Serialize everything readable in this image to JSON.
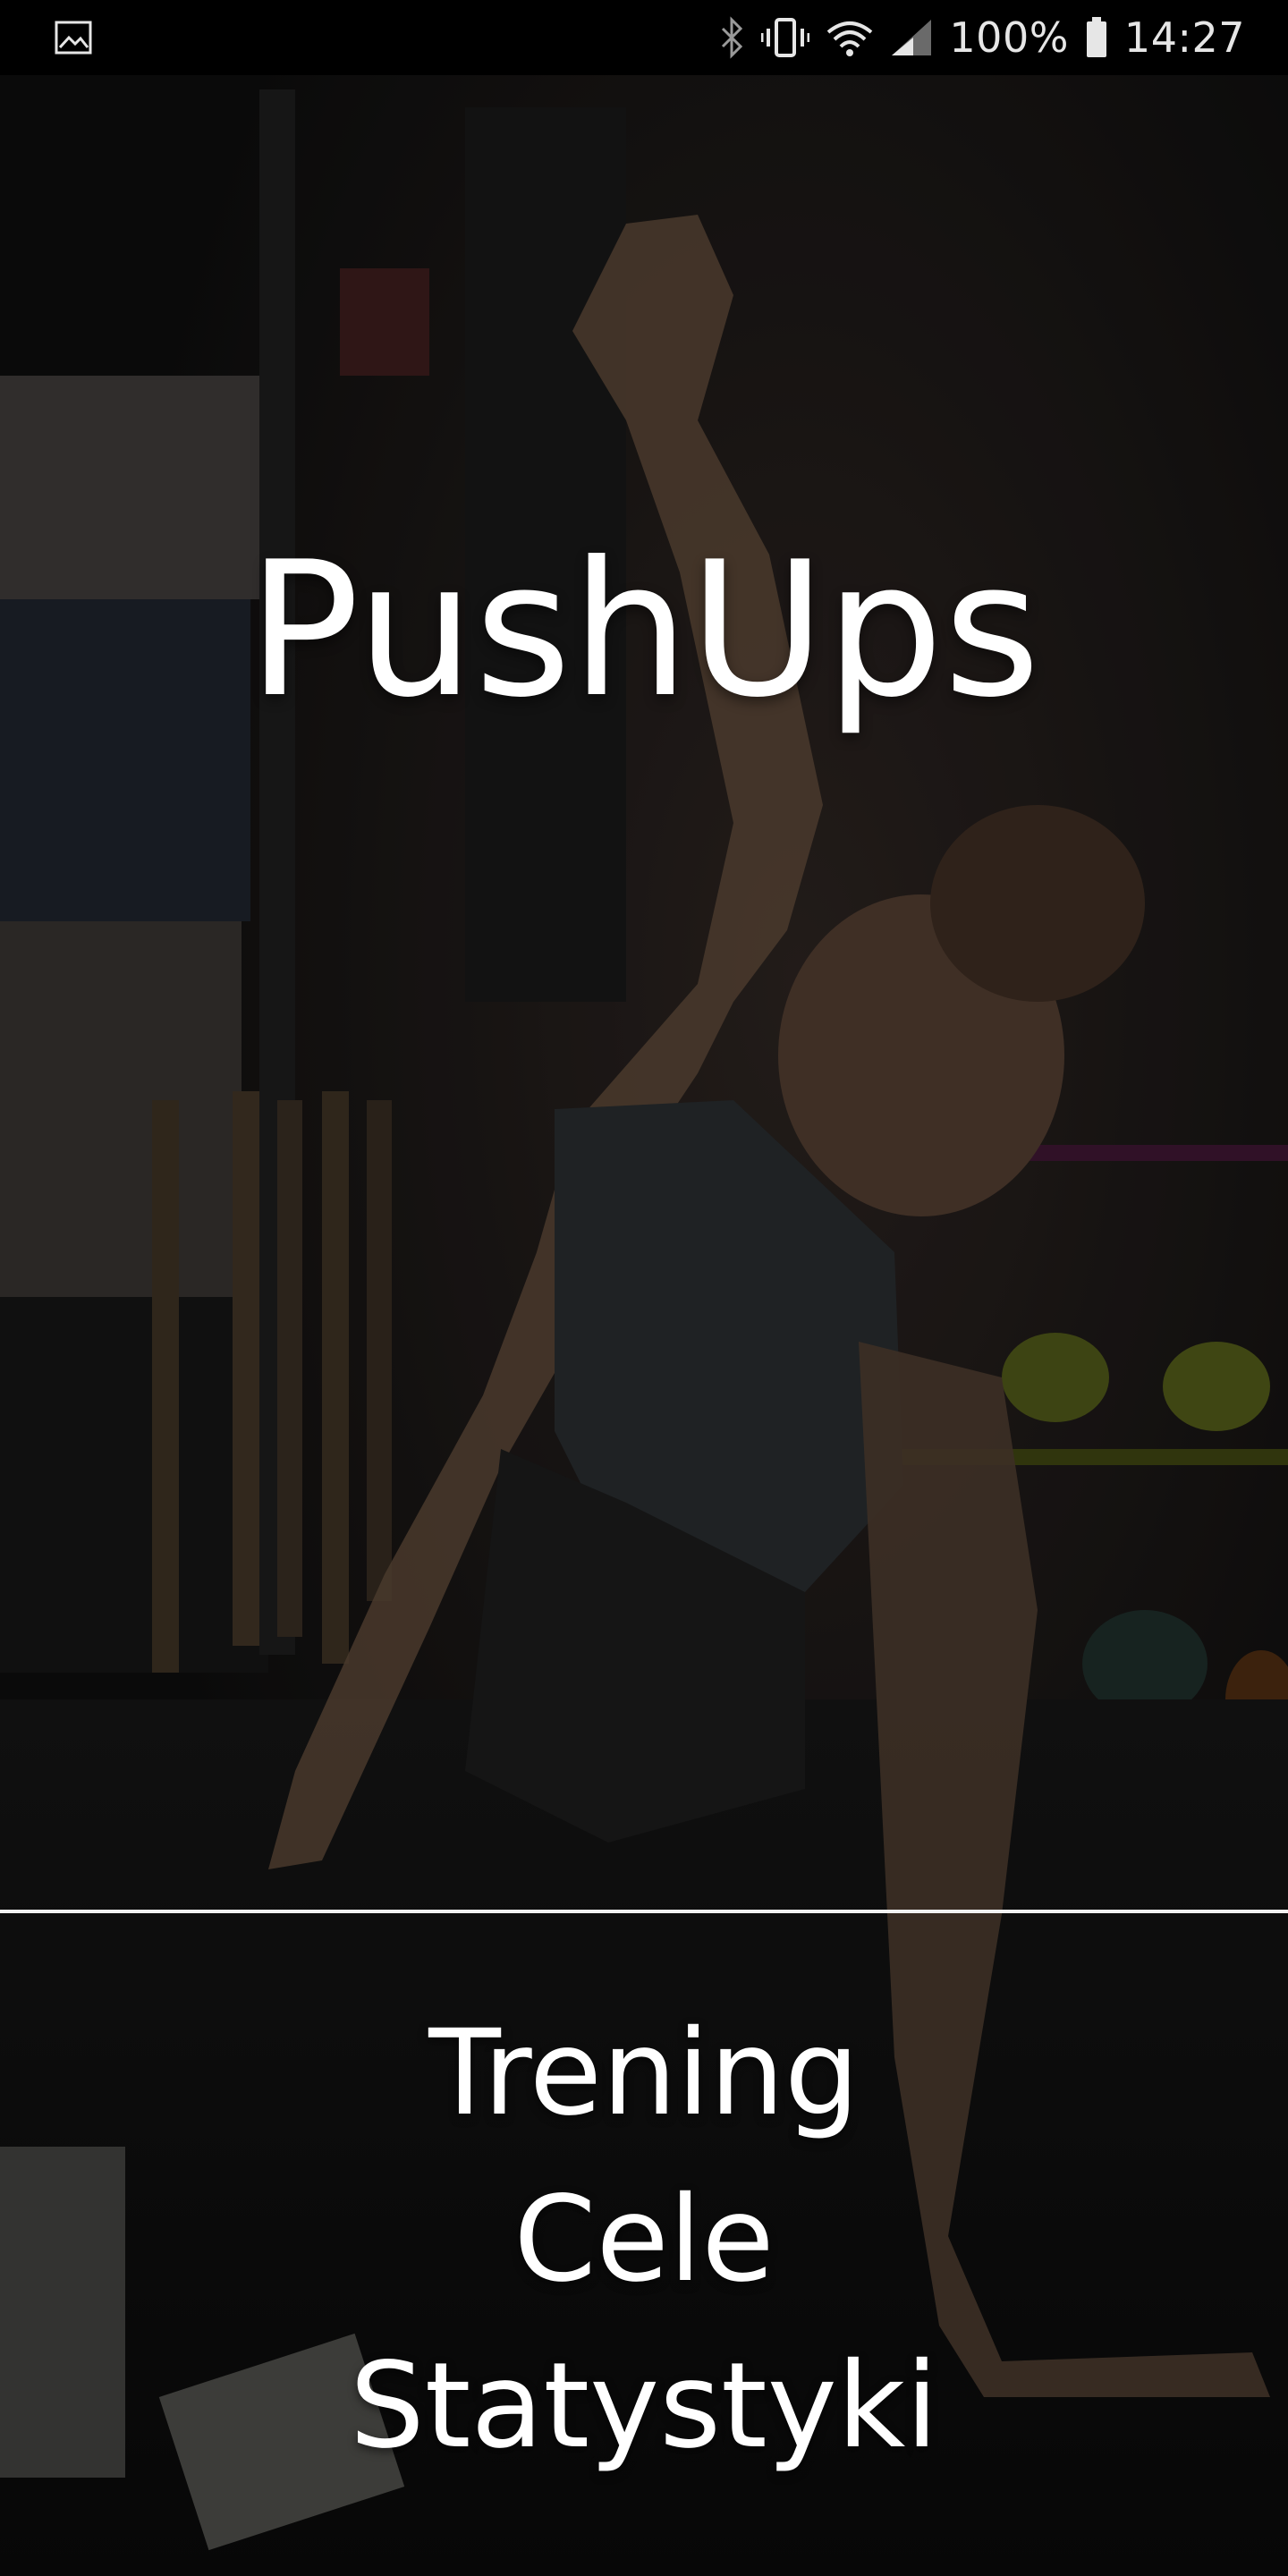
{
  "status_bar": {
    "icons": [
      "gallery-icon",
      "bluetooth-icon",
      "vibrate-icon",
      "wifi-icon",
      "signal-icon",
      "battery-icon"
    ],
    "battery_percent": "100%",
    "time": "14:27"
  },
  "app": {
    "title": "PushUps"
  },
  "menu": {
    "items": [
      {
        "label": "Trening"
      },
      {
        "label": "Cele"
      },
      {
        "label": "Statystyki"
      }
    ]
  },
  "colors": {
    "text": "#ffffff",
    "status_bar_bg": "#000000",
    "divider": "#f2f2f2"
  }
}
